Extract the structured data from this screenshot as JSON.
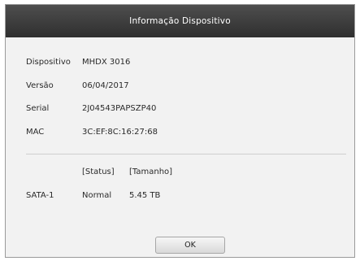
{
  "dialog": {
    "title": "Informação Dispositivo",
    "fields": [
      {
        "label": "Dispositivo",
        "value": "MHDX 3016"
      },
      {
        "label": "Versão",
        "value": "06/04/2017"
      },
      {
        "label": "Serial",
        "value": "2J04543PAPSZP40"
      },
      {
        "label": "MAC",
        "value": "3C:EF:8C:16:27:68"
      }
    ],
    "storage": {
      "header_status": "[Status]",
      "header_size": "[Tamanho]",
      "disks": [
        {
          "name": "SATA-1",
          "status": "Normal",
          "size": "5.45 TB"
        }
      ]
    },
    "ok_label": "OK"
  }
}
